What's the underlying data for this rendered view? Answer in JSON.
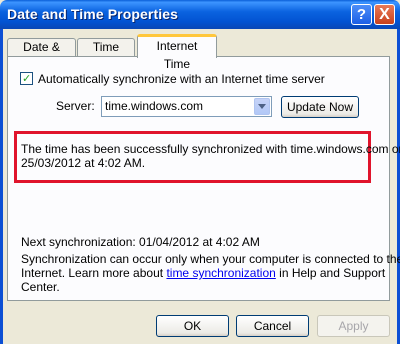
{
  "window": {
    "title": "Date and Time Properties",
    "help_symbol": "?",
    "close_symbol": "X"
  },
  "tabs": [
    {
      "label": "Date & Time"
    },
    {
      "label": "Time Zone"
    },
    {
      "label": "Internet Time",
      "selected": true
    }
  ],
  "internet_time": {
    "auto_sync_label": "Automatically synchronize with an Internet time server",
    "auto_sync_checked": true,
    "server_label": "Server:",
    "server_value": "time.windows.com",
    "update_button": "Update Now",
    "status_line1": "The time has been successfully synchronized with time.windows.com on",
    "status_line2": "25/03/2012 at 4:02 AM.",
    "next_sync": "Next synchronization: 01/04/2012 at 4:02 AM",
    "note_line1": "Synchronization can occur only when your computer is connected to the",
    "note_line2_prefix": "Internet.  Learn more about ",
    "note_link": "time synchronization",
    "note_line2_suffix": " in Help and Support",
    "note_line3": "Center."
  },
  "buttons": {
    "ok": "OK",
    "cancel": "Cancel",
    "apply": "Apply"
  },
  "colors": {
    "titlebar": "#0253d2",
    "highlight_box": "#e0142c",
    "link": "#0000ee"
  }
}
